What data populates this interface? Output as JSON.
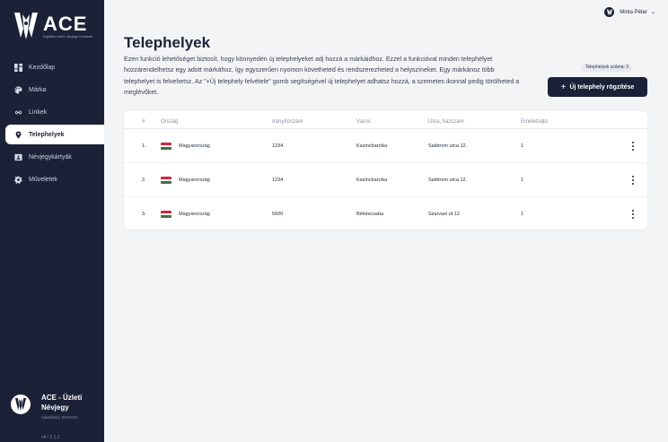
{
  "app": {
    "logo_text": "ACE",
    "logo_subtitle": "Digitális üzleti névjegy rendszer"
  },
  "sidebar": {
    "items": [
      {
        "label": "Kezdőlap",
        "icon": "dashboard-icon",
        "active": false
      },
      {
        "label": "Márka",
        "icon": "palette-icon",
        "active": false
      },
      {
        "label": "Linkek",
        "icon": "link-icon",
        "active": false
      },
      {
        "label": "Telephelyek",
        "icon": "location-pin-icon",
        "active": true
      },
      {
        "label": "Névjegykártyák",
        "icon": "contact-card-icon",
        "active": false
      },
      {
        "label": "Műveletek",
        "icon": "gear-icon",
        "active": false
      }
    ],
    "brand_name": "ACE - Üzleti Névjegy",
    "brand_meta": "Ajánlókód: XXXXXX",
    "version": "v4 / 2.1.2"
  },
  "topbar": {
    "user_name": "Minta Péter"
  },
  "page": {
    "title": "Telephelyek",
    "description": "Ezen funkció lehetőséget biztosít, hogy könnyedén új telephelyeket adj hozzá a márkáidhoz. Ezzel a funkcióval minden telephelyet hozzárendelhetsz egy adott márkához, így egyszerűen nyomon követheted és rendszerezheted a helyszíneket. Egy márkánoz több telephelyet is felvehetsz. Az \"+Új telephely felvétele\" gomb segítségével új telephelyet adhatsz hozzá, a szemetes ikonnal pedig törölheted a meglévőket.",
    "count_label": "Telephelyek száma: 3",
    "add_button_label": "Új telephely rögzítése"
  },
  "table": {
    "columns": [
      "#",
      "Ország",
      "Irányítószám",
      "Város",
      "Utca, házszám",
      "Emelet/ajtó"
    ],
    "rows": [
      {
        "num": "1.",
        "country": "Magyarország",
        "zip": "1234",
        "city": "Kazincbarcika",
        "street": "Salétrom utca 12.",
        "floor": "1"
      },
      {
        "num": "2.",
        "country": "Magyarország",
        "zip": "1234",
        "city": "Kazincbarcika",
        "street": "Salétrom utca 12.",
        "floor": "1"
      },
      {
        "num": "3.",
        "country": "Magyarország",
        "zip": "5600",
        "city": "Békéscsaba",
        "street": "Szarvasi út 12.",
        "floor": "1"
      }
    ]
  },
  "colors": {
    "sidebar_bg": "#1b2238",
    "primary": "#1b2238",
    "page_bg": "#f3f4f6",
    "flag_red": "#cd2a3e",
    "flag_white": "#ffffff",
    "flag_green": "#436f4d"
  }
}
